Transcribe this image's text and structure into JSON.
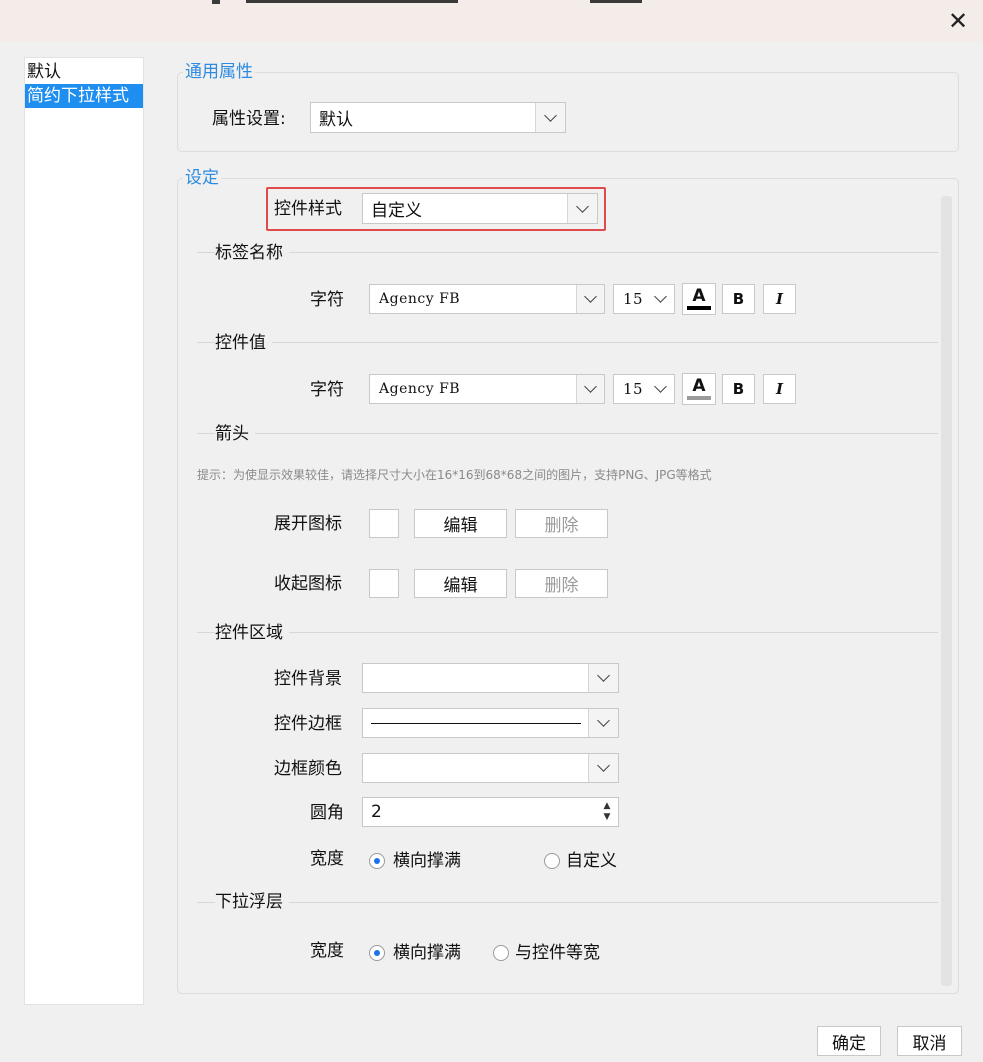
{
  "window": {
    "close_icon": "close-icon"
  },
  "sidebar": {
    "items": [
      {
        "label": "默认",
        "selected": false
      },
      {
        "label": "简约下拉样式",
        "selected": true
      }
    ]
  },
  "general": {
    "title": "通用属性",
    "property_label": "属性设置:",
    "property_value": "默认"
  },
  "settings": {
    "title": "设定",
    "control_style_label": "控件样式",
    "control_style_value": "自定义",
    "label_name": {
      "title": "标签名称",
      "font_label": "字符",
      "font_name": "Agency FB",
      "font_size": "15",
      "color_btn": "A",
      "bold_btn": "B",
      "italic_btn": "I",
      "underline_color": "#000000"
    },
    "control_value": {
      "title": "控件值",
      "font_label": "字符",
      "font_name": "Agency FB",
      "font_size": "15",
      "color_btn": "A",
      "bold_btn": "B",
      "italic_btn": "I",
      "underline_color": "#9a9a9a"
    },
    "arrow": {
      "title": "箭头",
      "hint": "提示：为使显示效果较佳，请选择尺寸大小在16*16到68*68之间的图片，支持PNG、JPG等格式",
      "expand_label": "展开图标",
      "collapse_label": "收起图标",
      "edit_btn": "编辑",
      "delete_btn": "删除"
    },
    "control_area": {
      "title": "控件区域",
      "background_label": "控件背景",
      "border_label": "控件边框",
      "border_color_label": "边框颜色",
      "radius_label": "圆角",
      "radius_value": "2",
      "width_label": "宽度",
      "width_option_fill": "横向撑满",
      "width_option_custom": "自定义",
      "width_selected": "横向撑满"
    },
    "dropdown_layer": {
      "title": "下拉浮层",
      "width_label": "宽度",
      "width_option_fill": "横向撑满",
      "width_option_same": "与控件等宽",
      "width_selected": "横向撑满"
    }
  },
  "footer": {
    "ok": "确定",
    "cancel": "取消"
  },
  "colors": {
    "accent": "#1e8ef0",
    "highlight_frame": "#e04a4a",
    "group_title": "#2e8be0"
  }
}
